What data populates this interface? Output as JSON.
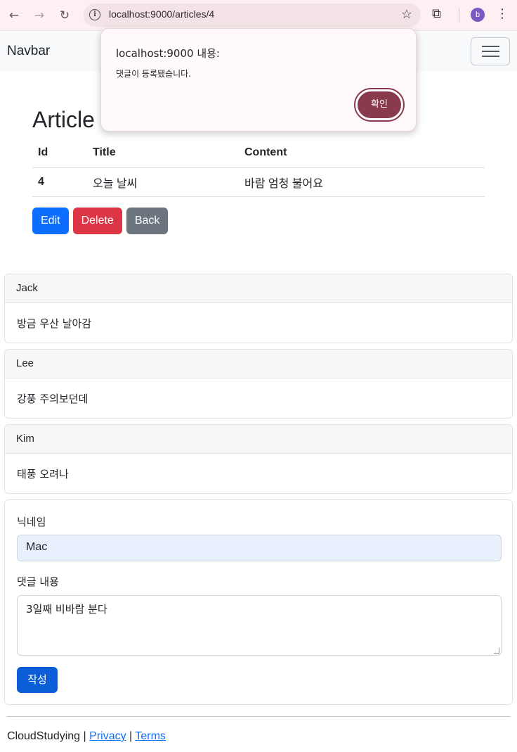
{
  "browser": {
    "url": "localhost:9000/articles/4",
    "avatar_letter": "b"
  },
  "navbar": {
    "brand": "Navbar"
  },
  "article": {
    "title": "Article",
    "columns": [
      "Id",
      "Title",
      "Content"
    ],
    "row": {
      "id": "4",
      "title": "오늘 날씨",
      "content": "바람 엄청 불어요"
    },
    "buttons": {
      "edit": "Edit",
      "delete": "Delete",
      "back": "Back"
    }
  },
  "comments": [
    {
      "nickname": "Jack",
      "body": "방금 우산 날아감"
    },
    {
      "nickname": "Lee",
      "body": "강풍 주의보던데"
    },
    {
      "nickname": "Kim",
      "body": "태풍 오려나"
    }
  ],
  "form": {
    "nickname_label": "닉네임",
    "nickname_value": "Mac",
    "body_label": "댓글 내용",
    "body_value": "3일째 비바람 분다",
    "submit_label": "작성"
  },
  "footer": {
    "brand": "CloudStudying",
    "sep": "|",
    "privacy": "Privacy",
    "terms": "Terms"
  },
  "alert": {
    "title": "localhost:9000 내용:",
    "message": "댓글이 등록됐습니다.",
    "ok": "확인"
  }
}
